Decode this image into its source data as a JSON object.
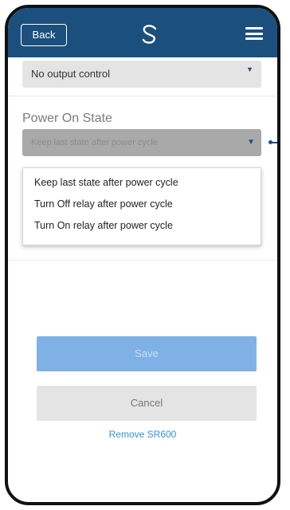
{
  "header": {
    "back_label": "Back",
    "logo_icon": "salus-logo-icon",
    "menu_icon": "hamburger-menu-icon",
    "background_color": "#1b4f7d"
  },
  "output_control": {
    "selected_value": "No output control"
  },
  "power_on_state": {
    "label": "Power On State",
    "selected_value": "Keep last state after power cycle",
    "options": [
      "Keep last state after power cycle",
      "Turn Off relay after power cycle",
      "Turn On relay after power cycle"
    ]
  },
  "actions": {
    "save_label": "Save",
    "cancel_label": "Cancel",
    "remove_label": "Remove SR600"
  },
  "colors": {
    "accent": "#1b4f7d",
    "save_button": "#7fb1e6",
    "link": "#3b8ee0"
  }
}
